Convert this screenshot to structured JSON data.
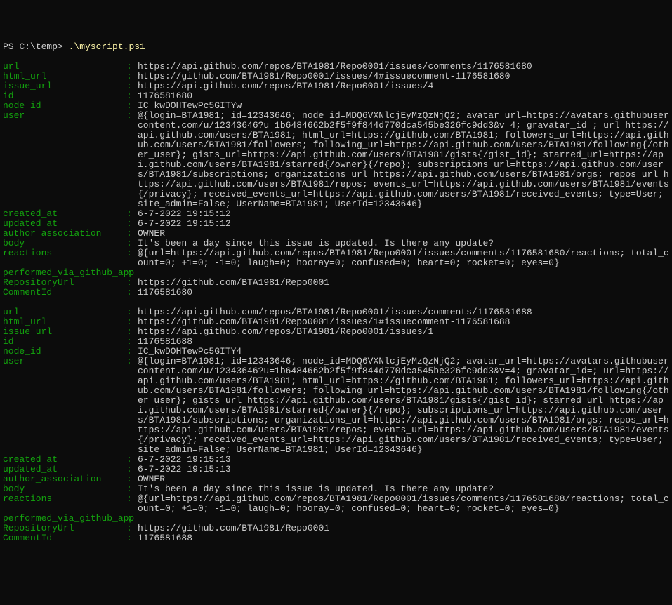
{
  "prompt_prefix": "PS C:\\temp> ",
  "command": ".\\myscript.ps1",
  "records": [
    {
      "url": "https://api.github.com/repos/BTA1981/Repo0001/issues/comments/1176581680",
      "html_url": "https://github.com/BTA1981/Repo0001/issues/4#issuecomment-1176581680",
      "issue_url": "https://api.github.com/repos/BTA1981/Repo0001/issues/4",
      "id": "1176581680",
      "node_id": "IC_kwDOHTewPc5GITYw",
      "user": "@{login=BTA1981; id=12343646; node_id=MDQ6VXNlcjEyMzQzNjQ2; avatar_url=https://avatars.githubusercontent.com/u/12343646?u=1b6484662b2f5f9f844d770dca545be326fc9dd3&v=4; gravatar_id=; url=https://api.github.com/users/BTA1981; html_url=https://github.com/BTA1981; followers_url=https://api.github.com/users/BTA1981/followers; following_url=https://api.github.com/users/BTA1981/following{/other_user}; gists_url=https://api.github.com/users/BTA1981/gists{/gist_id}; starred_url=https://api.github.com/users/BTA1981/starred{/owner}{/repo}; subscriptions_url=https://api.github.com/users/BTA1981/subscriptions; organizations_url=https://api.github.com/users/BTA1981/orgs; repos_url=https://api.github.com/users/BTA1981/repos; events_url=https://api.github.com/users/BTA1981/events{/privacy}; received_events_url=https://api.github.com/users/BTA1981/received_events; type=User; site_admin=False; UserName=BTA1981; UserId=12343646}",
      "created_at": "6-7-2022 19:15:12",
      "updated_at": "6-7-2022 19:15:12",
      "author_association": "OWNER",
      "body": "It's been a day since this issue is updated. Is there any update?",
      "reactions": "@{url=https://api.github.com/repos/BTA1981/Repo0001/issues/comments/1176581680/reactions; total_count=0; +1=0; -1=0; laugh=0; hooray=0; confused=0; heart=0; rocket=0; eyes=0}",
      "performed_via_github_app": "",
      "RepositoryUrl": "https://github.com/BTA1981/Repo0001",
      "CommentId": "1176581680"
    },
    {
      "url": "https://api.github.com/repos/BTA1981/Repo0001/issues/comments/1176581688",
      "html_url": "https://github.com/BTA1981/Repo0001/issues/1#issuecomment-1176581688",
      "issue_url": "https://api.github.com/repos/BTA1981/Repo0001/issues/1",
      "id": "1176581688",
      "node_id": "IC_kwDOHTewPc5GITY4",
      "user": "@{login=BTA1981; id=12343646; node_id=MDQ6VXNlcjEyMzQzNjQ2; avatar_url=https://avatars.githubusercontent.com/u/12343646?u=1b6484662b2f5f9f844d770dca545be326fc9dd3&v=4; gravatar_id=; url=https://api.github.com/users/BTA1981; html_url=https://github.com/BTA1981; followers_url=https://api.github.com/users/BTA1981/followers; following_url=https://api.github.com/users/BTA1981/following{/other_user}; gists_url=https://api.github.com/users/BTA1981/gists{/gist_id}; starred_url=https://api.github.com/users/BTA1981/starred{/owner}{/repo}; subscriptions_url=https://api.github.com/users/BTA1981/subscriptions; organizations_url=https://api.github.com/users/BTA1981/orgs; repos_url=https://api.github.com/users/BTA1981/repos; events_url=https://api.github.com/users/BTA1981/events{/privacy}; received_events_url=https://api.github.com/users/BTA1981/received_events; type=User; site_admin=False; UserName=BTA1981; UserId=12343646}",
      "created_at": "6-7-2022 19:15:13",
      "updated_at": "6-7-2022 19:15:13",
      "author_association": "OWNER",
      "body": "It's been a day since this issue is updated. Is there any update?",
      "reactions": "@{url=https://api.github.com/repos/BTA1981/Repo0001/issues/comments/1176581688/reactions; total_count=0; +1=0; -1=0; laugh=0; hooray=0; confused=0; heart=0; rocket=0; eyes=0}",
      "performed_via_github_app": "",
      "RepositoryUrl": "https://github.com/BTA1981/Repo0001",
      "CommentId": "1176581688"
    }
  ],
  "field_order": [
    "url",
    "html_url",
    "issue_url",
    "id",
    "node_id",
    "user",
    "created_at",
    "updated_at",
    "author_association",
    "body",
    "reactions",
    "performed_via_github_app",
    "RepositoryUrl",
    "CommentId"
  ]
}
